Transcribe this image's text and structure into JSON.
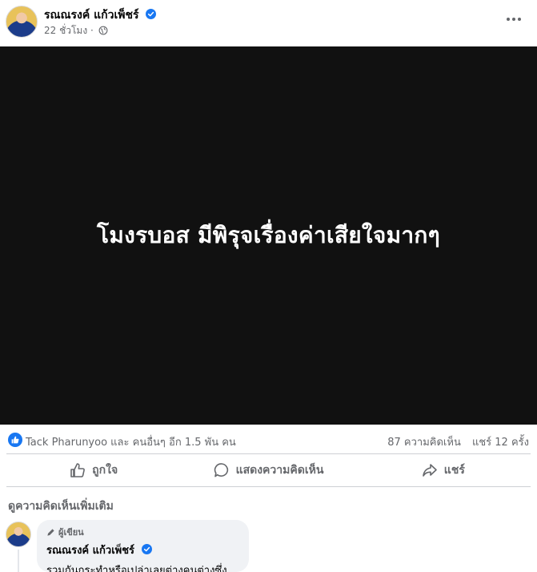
{
  "post": {
    "author": "รณณรงค์ แก้วเพ็ชร์",
    "time": "22 ชั่วโมง",
    "separator": "·",
    "privacy_icon": "globe-icon",
    "more_icon": "more-horizontal-icon",
    "media_text": "โมงรบอส มีพิรุจเรื่องค่าเสียใจมากๆ",
    "media_background": "#111111"
  },
  "stats": {
    "reaction_icon": "like-icon",
    "reactors": "Tack Pharunyoo และ คนอื่นๆ อีก 1.5 พัน คน",
    "comments": "87 ความคิดเห็น",
    "shares": "แชร์ 12 ครั้ง"
  },
  "actions": {
    "like": "ถูกใจ",
    "comment": "แสดงความคิดเห็น",
    "share": "แชร์"
  },
  "comments_section": {
    "more_label": "ดูความคิดเห็นเพิ่มเติม",
    "items": [
      {
        "badge": "ผู้เขียน",
        "author": "รณณรงค์ แก้วเพ็ชร์",
        "text": "รวมกันกระทำหรือเปล่าเลยต่างคนต่างซึ่ง"
      }
    ]
  },
  "colors": {
    "accent": "#1877f2",
    "muted_text": "#65676b",
    "bubble": "#f0f2f5"
  }
}
